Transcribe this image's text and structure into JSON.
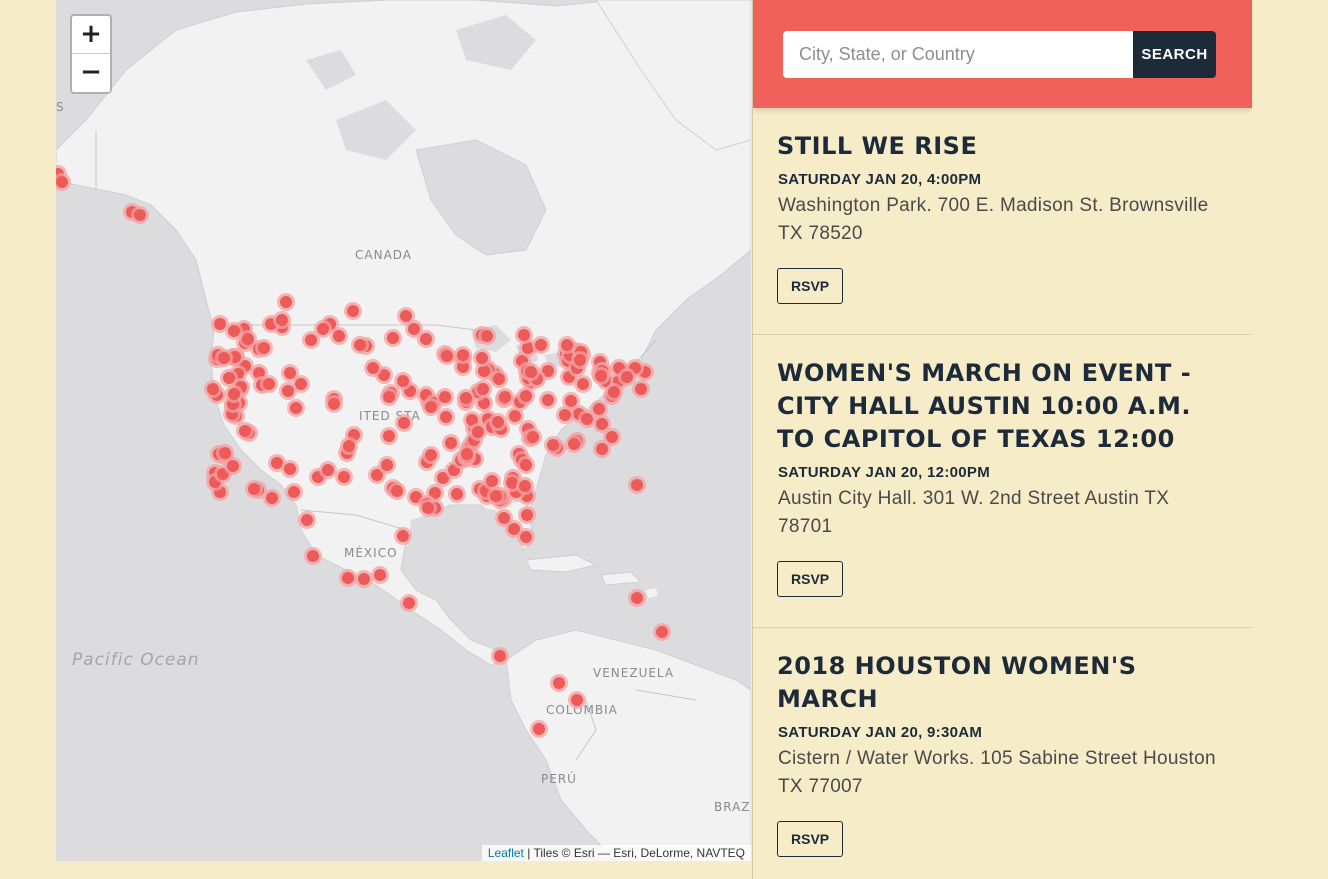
{
  "map": {
    "zoom_in_label": "+",
    "zoom_out_label": "−",
    "attribution_link": "Leaflet",
    "attribution_text": " | Tiles © Esri — Esri, DeLorme, NAVTEQ",
    "labels": {
      "canada": "CANADA",
      "united_states": "ITED STA",
      "mexico": "MÉXICO",
      "venezuela": "VENEZUELA",
      "colombia": "COLOMBIA",
      "peru": "PERÚ",
      "brazil": "BRAZI",
      "edge": "S",
      "pacific": "Pacific  Ocean"
    },
    "colors": {
      "land": "#f2f2f2",
      "water": "#dcdcdf",
      "marker": "#ec5a5a"
    }
  },
  "search": {
    "placeholder": "City, State, or Country",
    "button_label": "SEARCH"
  },
  "events": [
    {
      "title": "STILL WE RISE",
      "date": "SATURDAY JAN 20, 4:00PM",
      "address": "Washington Park. 700 E. Madison St. Brownsville TX 78520",
      "rsvp": "RSVP"
    },
    {
      "title": "WOMEN'S MARCH ON EVENT - CITY HALL AUSTIN 10:00 A.M. TO CAPITOL OF TEXAS 12:00",
      "date": "SATURDAY JAN 20, 12:00PM",
      "address": "Austin City Hall. 301 W. 2nd Street Austin TX 78701",
      "rsvp": "RSVP"
    },
    {
      "title": "2018 HOUSTON WOMEN'S MARCH",
      "date": "SATURDAY JAN 20, 9:30AM",
      "address": "Cistern / Water Works. 105 Sabine Street Houston TX 77007",
      "rsvp": "RSVP"
    }
  ]
}
